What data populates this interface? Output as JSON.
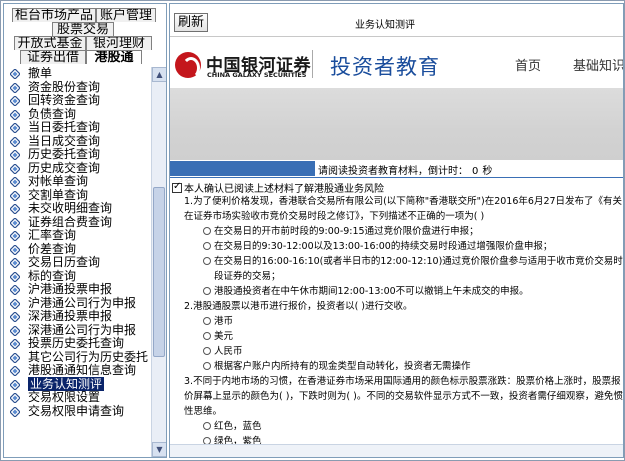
{
  "tabs": {
    "row1": [
      "柜台市场产品",
      "账户管理"
    ],
    "row2": [
      "股票交易"
    ],
    "row3": [
      "开放式基金",
      "银河理财"
    ],
    "row4": [
      "证券出借",
      "港股通"
    ]
  },
  "tree": {
    "items": [
      {
        "label": "撤单"
      },
      {
        "label": "资金股份查询"
      },
      {
        "label": "回转资金查询"
      },
      {
        "label": "负债查询"
      },
      {
        "label": "当日委托查询"
      },
      {
        "label": "当日成交查询"
      },
      {
        "label": "历史委托查询"
      },
      {
        "label": "历史成交查询"
      },
      {
        "label": "对帐单查询"
      },
      {
        "label": "交割单查询"
      },
      {
        "label": "未交收明细查询"
      },
      {
        "label": "证券组合费查询"
      },
      {
        "label": "汇率查询"
      },
      {
        "label": "价差查询"
      },
      {
        "label": "交易日历查询"
      },
      {
        "label": "标的查询"
      },
      {
        "label": "沪港通投票申报"
      },
      {
        "label": "沪港通公司行为申报"
      },
      {
        "label": "深港通投票申报"
      },
      {
        "label": "深港通公司行为申报"
      },
      {
        "label": "投票历史委托查询"
      },
      {
        "label": "其它公司行为历史委托"
      },
      {
        "label": "港股通通知信息查询"
      },
      {
        "label": "业务认知测评",
        "selected": true
      },
      {
        "label": "交易权限设置"
      },
      {
        "label": "交易权限申请查询"
      }
    ]
  },
  "toolbar": {
    "refresh_label": "刷新",
    "window_title": "业务认知测评"
  },
  "brand": {
    "name_cn": "中国银河证券",
    "name_en": "CHINA GALAXY SECURITIES",
    "section": "投资者教育",
    "nav_home": "首页",
    "nav_basic": "基础知识"
  },
  "timer": {
    "prompt": "请阅读投资者教育材料，倒计时：",
    "value": "0",
    "unit": "秒"
  },
  "confirm": {
    "label": "本人确认已阅读上述材料了解港股通业务风险"
  },
  "questions": [
    {
      "text": "1.为了便利价格发现，香港联合交易所有限公司(以下简称\"香港联交所\")在2016年6月27日发布了《有关在证券市场实验收市竞价交易时段之修订》，下列描述不正确的一项为(  )",
      "options": [
        "在交易日的开市前时段的9:00-9:15通过竞价限价盘进行申报；",
        "在交易日的9:30-12:00以及13:00-16:00的持续交易时段通过增强限价盘申报；",
        "在交易日的16:00-16:10(或者半日市的12:00-12:10)通过竞价限价盘参与适用于收市竞价交易时段证券的交易；",
        "港股通投资者在中午休市期间12:00-13:00不可以撤销上午未成交的申报。"
      ]
    },
    {
      "text": "2.港股通股票以港币进行报价，投资者以(  )进行交收。",
      "options": [
        "港币",
        "美元",
        "人民币",
        "根据客户账户内所持有的现金类型自动转化，投资者无需操作"
      ]
    },
    {
      "text": "3.不同于内地市场的习惯，在香港证券市场采用国际通用的颜色标示股票涨跌：股票价格上涨时，股票报价屏幕上显示的颜色为(  )，下跌时则为(  )。不同的交易软件显示方式不一致，投资者需仔细观察，避免惯性思维。",
      "options": [
        "红色，蓝色",
        "绿色，紫色"
      ]
    }
  ]
}
